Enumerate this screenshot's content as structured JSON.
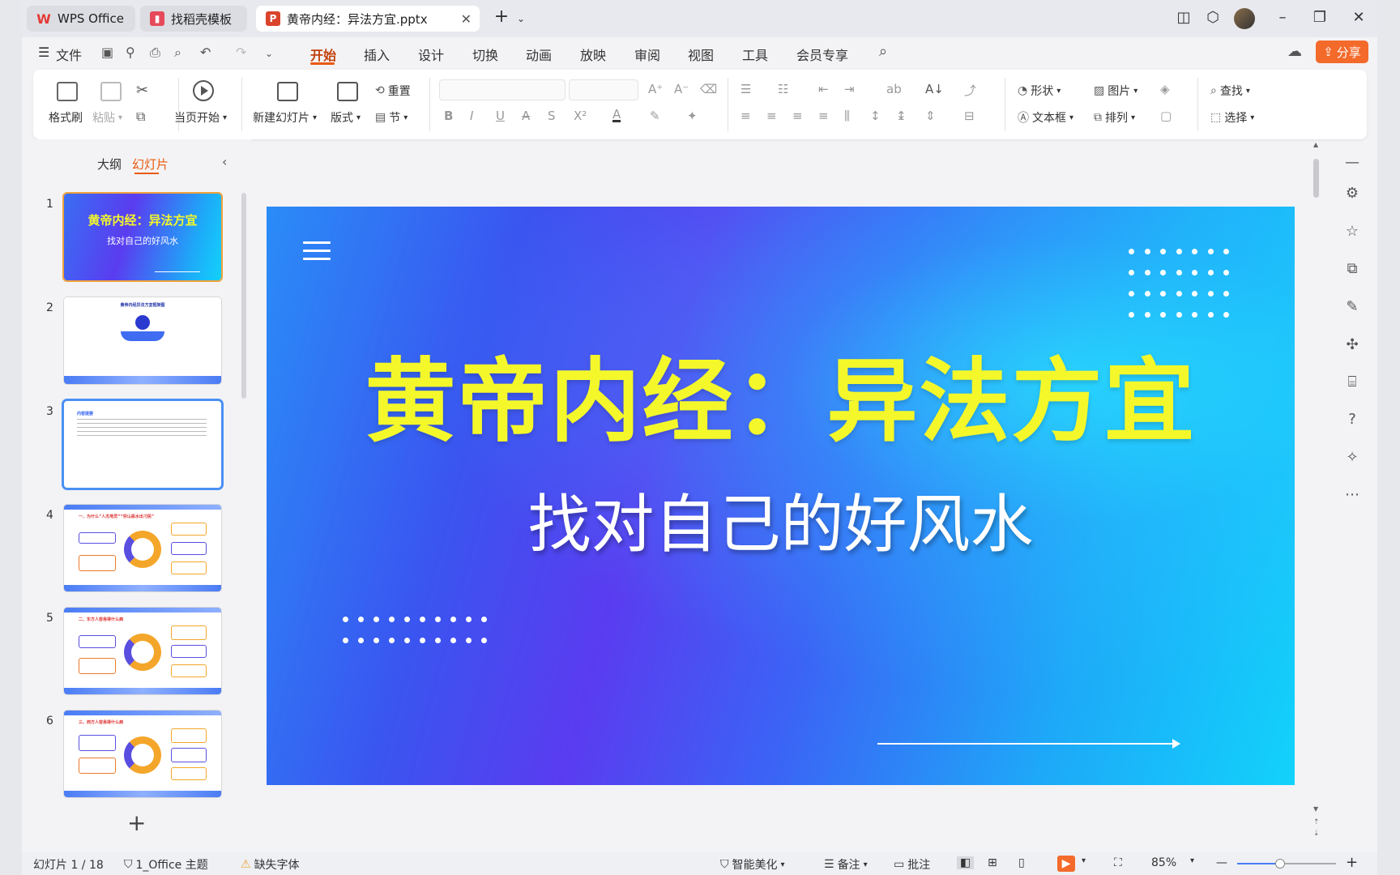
{
  "tabs": [
    {
      "label": "WPS Office",
      "icon": "wps-logo-icon"
    },
    {
      "label": "找稻壳模板",
      "icon": "docer-icon"
    },
    {
      "label": "黄帝内经：异法方宜.pptx",
      "icon": "ppt-file-icon"
    }
  ],
  "menu": {
    "file": "文件",
    "items": [
      "开始",
      "插入",
      "设计",
      "切换",
      "动画",
      "放映",
      "审阅",
      "视图",
      "工具",
      "会员专享"
    ],
    "active": "开始",
    "share": "分享"
  },
  "ribbon": {
    "format_painter": "格式刷",
    "paste": "粘贴",
    "start_from_current": "当页开始",
    "new_slide": "新建幻灯片",
    "layout": "版式",
    "reset": "重置",
    "section": "节",
    "shape": "形状",
    "picture": "图片",
    "textbox": "文本框",
    "arrange": "排列",
    "find": "查找",
    "select": "选择",
    "font_buttons": [
      "B",
      "I",
      "U",
      "A",
      "S",
      "X²",
      "A"
    ]
  },
  "panel": {
    "outline_tab": "大纲",
    "slides_tab": "幻灯片",
    "add_label": "+"
  },
  "thumbnails": [
    {
      "num": "1",
      "title": "黄帝内经：异法方宜",
      "subtitle": "找对自己的好风水"
    },
    {
      "num": "2",
      "title": "黄帝内经异法方宜框架图"
    },
    {
      "num": "3",
      "title": "内容提要"
    },
    {
      "num": "4",
      "title": "一、为什么“人杰地灵”“穷山恶水出刁民”"
    },
    {
      "num": "5",
      "title": "二、东方人容易得什么病"
    },
    {
      "num": "6",
      "title": "三、西方人容易得什么病"
    }
  ],
  "slide": {
    "title": "黄帝内经：异法方宜",
    "subtitle": "找对自己的好风水"
  },
  "status": {
    "slide_info": "幻灯片 1 / 18",
    "theme": "1_Office 主题",
    "missing_font": "缺失字体",
    "smart_beautify": "智能美化",
    "notes": "备注",
    "comments": "批注",
    "zoom": "85%"
  },
  "colors": {
    "accent": "#ea580c",
    "share_bg": "#f46a2b",
    "title_yellow": "#f4f82a",
    "selected_thumb_border": "#f0a23c"
  }
}
